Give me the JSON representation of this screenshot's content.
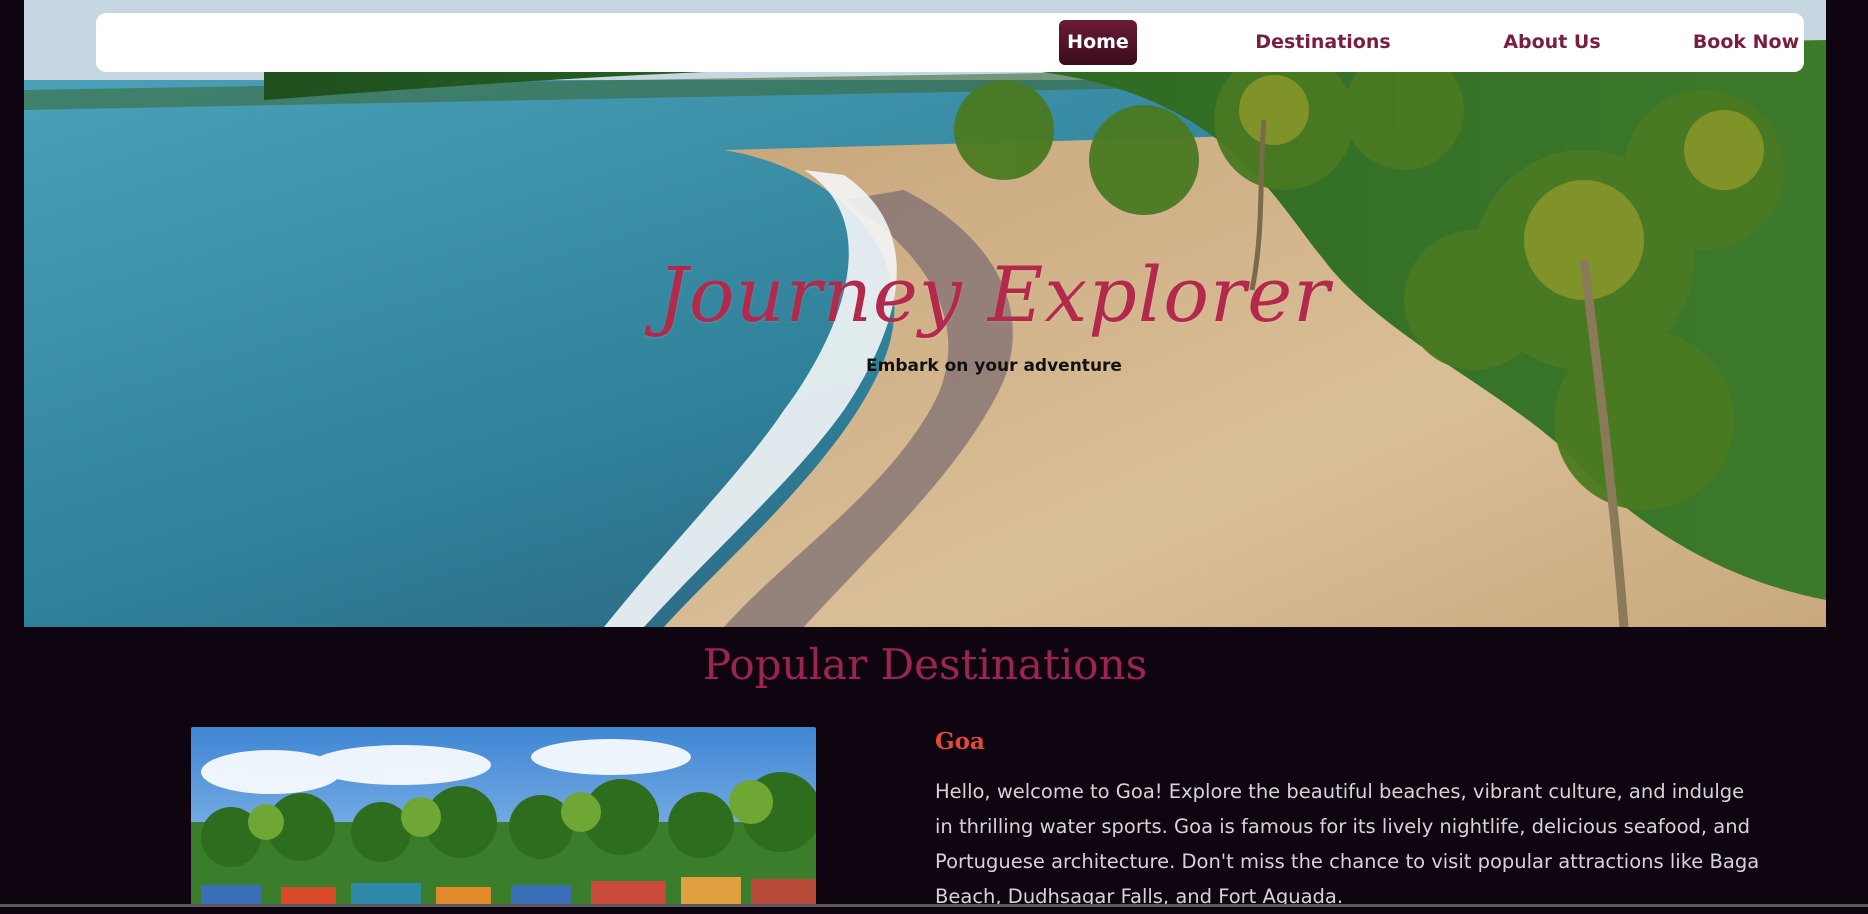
{
  "nav": {
    "home_label": "Home",
    "destinations_label": "Destinations",
    "about_label": "About Us",
    "book_label": "Book Now"
  },
  "hero": {
    "title": "Journey Explorer",
    "subtitle": "Embark on your adventure"
  },
  "destinations": {
    "section_title": "Popular Destinations",
    "items": [
      {
        "name": "Goa",
        "description": "Hello, welcome to Goa! Explore the beautiful beaches, vibrant culture, and indulge in thrilling water sports. Goa is famous for its lively nightlife, delicious seafood, and Portuguese architecture. Don't miss the chance to visit popular attractions like Baga Beach, Dudhsagar Falls, and Fort Aguada."
      }
    ]
  },
  "colors": {
    "background": "#0e0510",
    "accent": "#7a1e3e",
    "title": "#b3294c",
    "destination_name": "#e0493a"
  }
}
